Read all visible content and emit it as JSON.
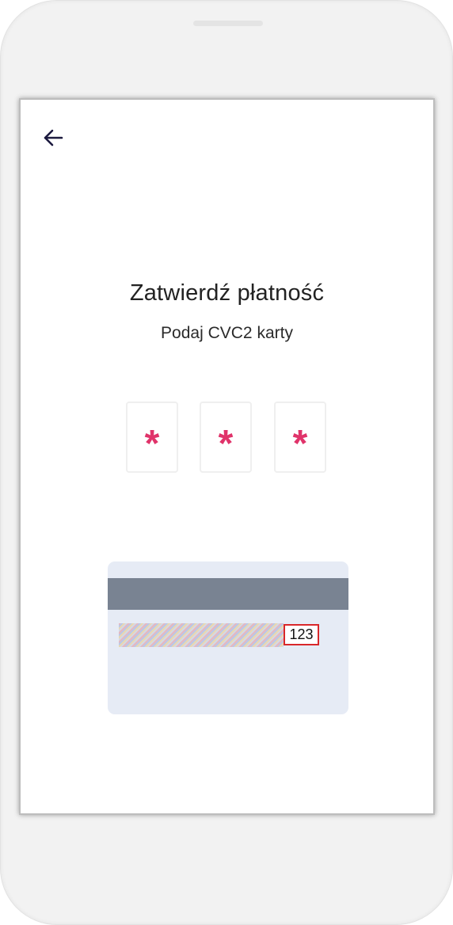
{
  "header": {
    "back_icon": "arrow-left-icon"
  },
  "main": {
    "title": "Zatwierdź płatność",
    "subtitle": "Podaj CVC2 karty",
    "digits": [
      "*",
      "*",
      "*"
    ]
  },
  "card_illustration": {
    "cvc_example": "123"
  },
  "colors": {
    "accent": "#e0336a",
    "magnetic_stripe": "#798392",
    "card_background": "#e6ebf5",
    "cvc_highlight": "#d9272a",
    "back_icon": "#1c1a3f"
  }
}
